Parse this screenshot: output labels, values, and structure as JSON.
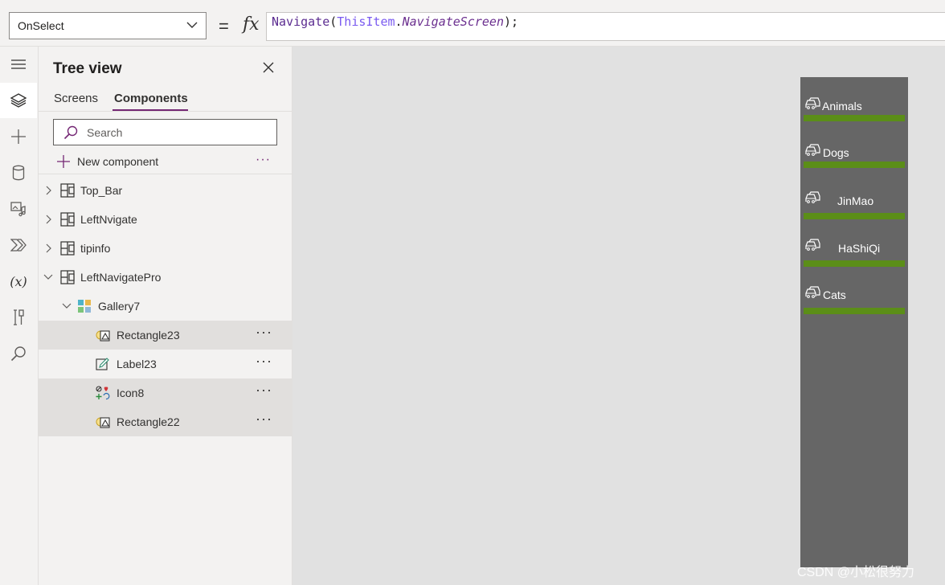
{
  "formula_bar": {
    "property": "OnSelect",
    "equals": "=",
    "fx_label": "fx",
    "formula": {
      "fn": "Navigate",
      "open": "(",
      "obj": "ThisItem",
      "dot": ".",
      "prop": "NavigateScreen",
      "close": ");"
    }
  },
  "rail": {
    "items": [
      {
        "icon": "hamburger-icon"
      },
      {
        "icon": "layers-icon",
        "active": true
      },
      {
        "icon": "plus-icon"
      },
      {
        "icon": "database-icon"
      },
      {
        "icon": "media-icon"
      },
      {
        "icon": "power-automate-icon"
      },
      {
        "icon": "variables-icon",
        "text": "(x)"
      },
      {
        "icon": "tools-icon"
      },
      {
        "icon": "search-icon"
      }
    ]
  },
  "tree_view": {
    "title": "Tree view",
    "tabs": [
      "Screens",
      "Components"
    ],
    "selected_tab": "Components",
    "search_placeholder": "Search",
    "new_component": "New component",
    "more": "···",
    "items": [
      {
        "label": "Top_Bar",
        "level": 0,
        "expanded": false,
        "icon": "component-icon"
      },
      {
        "label": "LeftNvigate",
        "level": 0,
        "expanded": false,
        "icon": "component-icon"
      },
      {
        "label": "tipinfo",
        "level": 0,
        "expanded": false,
        "icon": "component-icon"
      },
      {
        "label": "LeftNavigatePro",
        "level": 0,
        "expanded": true,
        "icon": "component-icon"
      },
      {
        "label": "Gallery7",
        "level": 1,
        "expanded": true,
        "icon": "gallery-icon"
      },
      {
        "label": "Rectangle23",
        "level": 2,
        "icon": "shape-icon",
        "shaded": true,
        "menu": "···"
      },
      {
        "label": "Label23",
        "level": 2,
        "icon": "label-edit-icon",
        "shaded": false,
        "menu": "···"
      },
      {
        "label": "Icon8",
        "level": 2,
        "icon": "icons-icon",
        "shaded": true,
        "menu": "···"
      },
      {
        "label": "Rectangle22",
        "level": 2,
        "icon": "shape-icon",
        "shaded": true,
        "menu": "···"
      }
    ]
  },
  "canvas": {
    "nav_items": [
      {
        "label": "Animals"
      },
      {
        "label": "Dogs"
      },
      {
        "label": "JinMao"
      },
      {
        "label": "HaShiQi"
      },
      {
        "label": "Cats"
      }
    ],
    "colors": {
      "panel": "#666666",
      "bar": "#5b8e18",
      "label": "#ffffff"
    }
  },
  "watermark": "CSDN @小松很努力"
}
